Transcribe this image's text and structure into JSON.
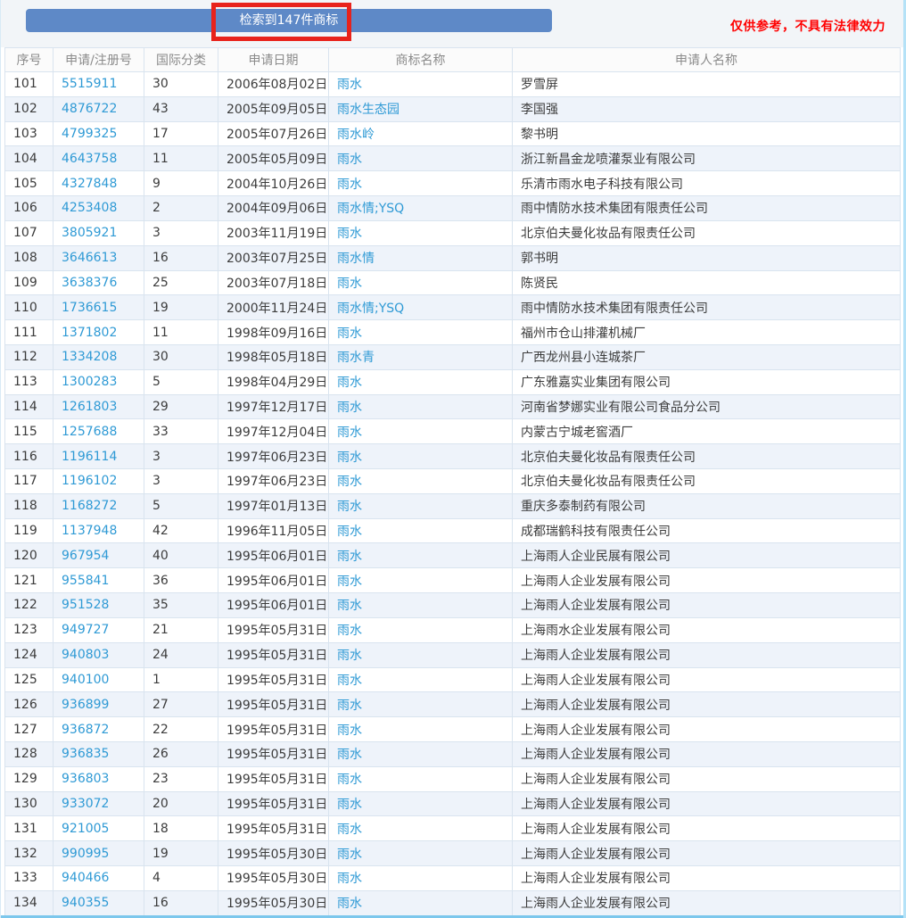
{
  "topbar": {
    "result_button_label": "检索到147件商标",
    "disclaimer": "仅供参考，不具有法律效力"
  },
  "colors": {
    "button_blue": "#5e89c7",
    "annotation_red": "#e8231c",
    "disclaimer_red": "#ff0000",
    "link_blue": "#2f9ad5",
    "row_alt_blue": "#eef3fa",
    "grid_line": "#d9e4ef"
  },
  "table": {
    "columns": [
      "序号",
      "申请/注册号",
      "国际分类",
      "申请日期",
      "商标名称",
      "申请人名称"
    ],
    "rows": [
      {
        "no": "101",
        "reg_no": "5515911",
        "intl_class": "30",
        "app_date": "2006年08月02日",
        "trademark": "雨水",
        "applicant": "罗雪屏"
      },
      {
        "no": "102",
        "reg_no": "4876722",
        "intl_class": "43",
        "app_date": "2005年09月05日",
        "trademark": "雨水生态园",
        "applicant": "李国强"
      },
      {
        "no": "103",
        "reg_no": "4799325",
        "intl_class": "17",
        "app_date": "2005年07月26日",
        "trademark": "雨水岭",
        "applicant": "黎书明"
      },
      {
        "no": "104",
        "reg_no": "4643758",
        "intl_class": "11",
        "app_date": "2005年05月09日",
        "trademark": "雨水",
        "applicant": "浙江新昌金龙喷灌泵业有限公司"
      },
      {
        "no": "105",
        "reg_no": "4327848",
        "intl_class": "9",
        "app_date": "2004年10月26日",
        "trademark": "雨水",
        "applicant": "乐清市雨水电子科技有限公司"
      },
      {
        "no": "106",
        "reg_no": "4253408",
        "intl_class": "2",
        "app_date": "2004年09月06日",
        "trademark": "雨水情;YSQ",
        "applicant": "雨中情防水技术集团有限责任公司"
      },
      {
        "no": "107",
        "reg_no": "3805921",
        "intl_class": "3",
        "app_date": "2003年11月19日",
        "trademark": "雨水",
        "applicant": "北京伯夫曼化妆品有限责任公司"
      },
      {
        "no": "108",
        "reg_no": "3646613",
        "intl_class": "16",
        "app_date": "2003年07月25日",
        "trademark": "雨水情",
        "applicant": "郭书明"
      },
      {
        "no": "109",
        "reg_no": "3638376",
        "intl_class": "25",
        "app_date": "2003年07月18日",
        "trademark": "雨水",
        "applicant": "陈贤民"
      },
      {
        "no": "110",
        "reg_no": "1736615",
        "intl_class": "19",
        "app_date": "2000年11月24日",
        "trademark": "雨水情;YSQ",
        "applicant": "雨中情防水技术集团有限责任公司"
      },
      {
        "no": "111",
        "reg_no": "1371802",
        "intl_class": "11",
        "app_date": "1998年09月16日",
        "trademark": "雨水",
        "applicant": "福州市仓山排灌机械厂"
      },
      {
        "no": "112",
        "reg_no": "1334208",
        "intl_class": "30",
        "app_date": "1998年05月18日",
        "trademark": "雨水青",
        "applicant": "广西龙州县小连城茶厂"
      },
      {
        "no": "113",
        "reg_no": "1300283",
        "intl_class": "5",
        "app_date": "1998年04月29日",
        "trademark": "雨水",
        "applicant": "广东雅嘉实业集团有限公司"
      },
      {
        "no": "114",
        "reg_no": "1261803",
        "intl_class": "29",
        "app_date": "1997年12月17日",
        "trademark": "雨水",
        "applicant": "河南省梦娜实业有限公司食品分公司"
      },
      {
        "no": "115",
        "reg_no": "1257688",
        "intl_class": "33",
        "app_date": "1997年12月04日",
        "trademark": "雨水",
        "applicant": "内蒙古宁城老窖酒厂"
      },
      {
        "no": "116",
        "reg_no": "1196114",
        "intl_class": "3",
        "app_date": "1997年06月23日",
        "trademark": "雨水",
        "applicant": "北京伯夫曼化妆品有限责任公司"
      },
      {
        "no": "117",
        "reg_no": "1196102",
        "intl_class": "3",
        "app_date": "1997年06月23日",
        "trademark": "雨水",
        "applicant": "北京伯夫曼化妆品有限责任公司"
      },
      {
        "no": "118",
        "reg_no": "1168272",
        "intl_class": "5",
        "app_date": "1997年01月13日",
        "trademark": "雨水",
        "applicant": "重庆多泰制药有限公司"
      },
      {
        "no": "119",
        "reg_no": "1137948",
        "intl_class": "42",
        "app_date": "1996年11月05日",
        "trademark": "雨水",
        "applicant": "成都瑞鹤科技有限责任公司"
      },
      {
        "no": "120",
        "reg_no": "967954",
        "intl_class": "40",
        "app_date": "1995年06月01日",
        "trademark": "雨水",
        "applicant": "上海雨人企业民展有限公司"
      },
      {
        "no": "121",
        "reg_no": "955841",
        "intl_class": "36",
        "app_date": "1995年06月01日",
        "trademark": "雨水",
        "applicant": "上海雨人企业发展有限公司"
      },
      {
        "no": "122",
        "reg_no": "951528",
        "intl_class": "35",
        "app_date": "1995年06月01日",
        "trademark": "雨水",
        "applicant": "上海雨人企业发展有限公司"
      },
      {
        "no": "123",
        "reg_no": "949727",
        "intl_class": "21",
        "app_date": "1995年05月31日",
        "trademark": "雨水",
        "applicant": "上海雨水企业发展有限公司"
      },
      {
        "no": "124",
        "reg_no": "940803",
        "intl_class": "24",
        "app_date": "1995年05月31日",
        "trademark": "雨水",
        "applicant": "上海雨人企业发展有限公司"
      },
      {
        "no": "125",
        "reg_no": "940100",
        "intl_class": "1",
        "app_date": "1995年05月31日",
        "trademark": "雨水",
        "applicant": "上海雨人企业发展有限公司"
      },
      {
        "no": "126",
        "reg_no": "936899",
        "intl_class": "27",
        "app_date": "1995年05月31日",
        "trademark": "雨水",
        "applicant": "上海雨人企业发展有限公司"
      },
      {
        "no": "127",
        "reg_no": "936872",
        "intl_class": "22",
        "app_date": "1995年05月31日",
        "trademark": "雨水",
        "applicant": "上海雨人企业发展有限公司"
      },
      {
        "no": "128",
        "reg_no": "936835",
        "intl_class": "26",
        "app_date": "1995年05月31日",
        "trademark": "雨水",
        "applicant": "上海雨人企业发展有限公司"
      },
      {
        "no": "129",
        "reg_no": "936803",
        "intl_class": "23",
        "app_date": "1995年05月31日",
        "trademark": "雨水",
        "applicant": "上海雨人企业发展有限公司"
      },
      {
        "no": "130",
        "reg_no": "933072",
        "intl_class": "20",
        "app_date": "1995年05月31日",
        "trademark": "雨水",
        "applicant": "上海雨人企业发展有限公司"
      },
      {
        "no": "131",
        "reg_no": "921005",
        "intl_class": "18",
        "app_date": "1995年05月31日",
        "trademark": "雨水",
        "applicant": "上海雨人企业发展有限公司"
      },
      {
        "no": "132",
        "reg_no": "990995",
        "intl_class": "19",
        "app_date": "1995年05月30日",
        "trademark": "雨水",
        "applicant": "上海雨人企业发展有限公司"
      },
      {
        "no": "133",
        "reg_no": "940466",
        "intl_class": "4",
        "app_date": "1995年05月30日",
        "trademark": "雨水",
        "applicant": "上海雨人企业发展有限公司"
      },
      {
        "no": "134",
        "reg_no": "940355",
        "intl_class": "16",
        "app_date": "1995年05月30日",
        "trademark": "雨水",
        "applicant": "上海雨人企业发展有限公司"
      }
    ]
  }
}
